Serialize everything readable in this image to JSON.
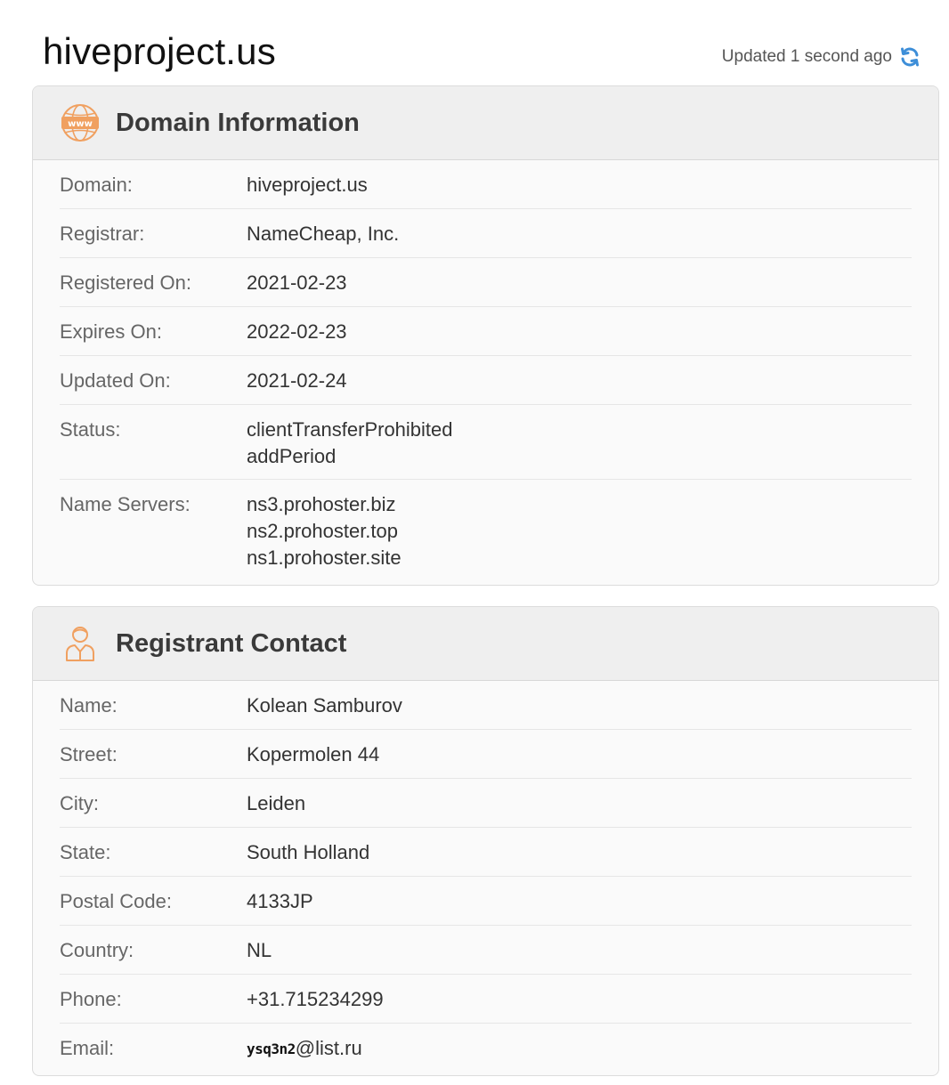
{
  "page": {
    "title": "hiveproject.us",
    "updated_text": "Updated 1 second ago"
  },
  "colors": {
    "accent_icon": "#f0a060",
    "refresh_blue": "#3d8ed8"
  },
  "domain_info": {
    "heading": "Domain Information",
    "icon": "www-globe-icon",
    "rows": [
      {
        "label": "Domain:",
        "values": [
          "hiveproject.us"
        ]
      },
      {
        "label": "Registrar:",
        "values": [
          "NameCheap, Inc."
        ]
      },
      {
        "label": "Registered On:",
        "values": [
          "2021-02-23"
        ]
      },
      {
        "label": "Expires On:",
        "values": [
          "2022-02-23"
        ]
      },
      {
        "label": "Updated On:",
        "values": [
          "2021-02-24"
        ]
      },
      {
        "label": "Status:",
        "values": [
          "clientTransferProhibited",
          "addPeriod"
        ]
      },
      {
        "label": "Name Servers:",
        "values": [
          "ns3.prohoster.biz",
          "ns2.prohoster.top",
          "ns1.prohoster.site"
        ]
      }
    ]
  },
  "registrant": {
    "heading": "Registrant Contact",
    "icon": "person-icon",
    "rows": [
      {
        "label": "Name:",
        "values": [
          "Kolean Samburov"
        ]
      },
      {
        "label": "Street:",
        "values": [
          "Kopermolen 44"
        ]
      },
      {
        "label": "City:",
        "values": [
          "Leiden"
        ]
      },
      {
        "label": "State:",
        "values": [
          "South Holland"
        ]
      },
      {
        "label": "Postal Code:",
        "values": [
          "4133JP"
        ]
      },
      {
        "label": "Country:",
        "values": [
          "NL"
        ]
      },
      {
        "label": "Phone:",
        "values": [
          "+31.715234299"
        ]
      }
    ],
    "email": {
      "label": "Email:",
      "user_image_text": "ysq3n2",
      "domain": "@list.ru"
    }
  }
}
